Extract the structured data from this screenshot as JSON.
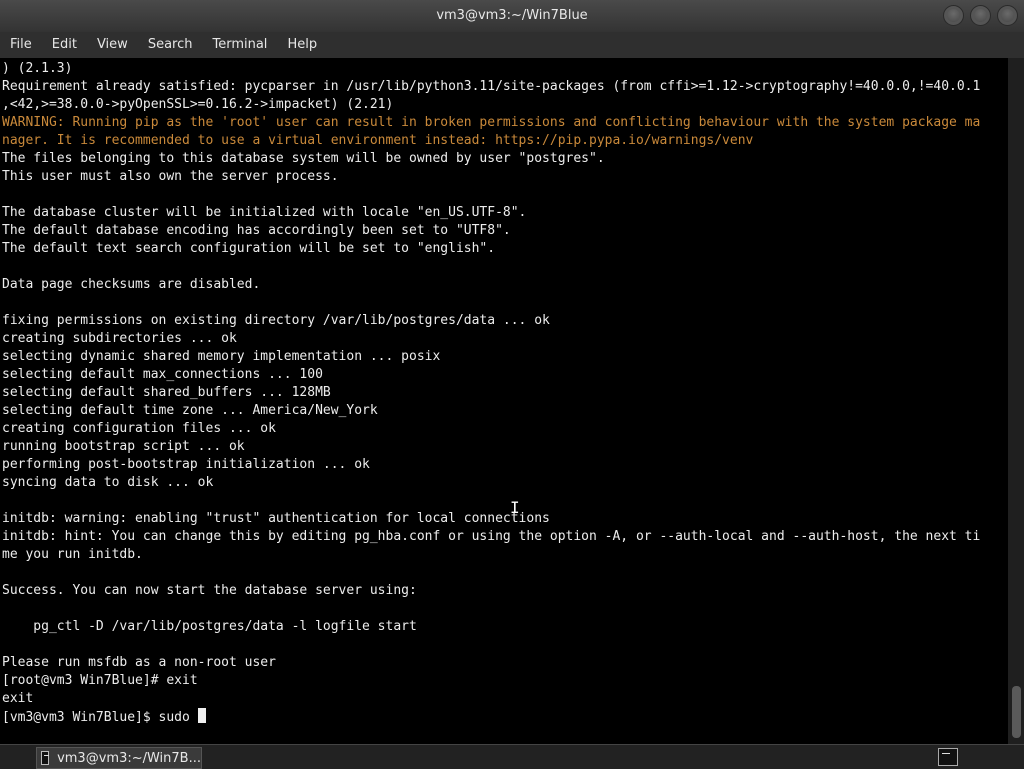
{
  "window": {
    "title": "vm3@vm3:~/Win7Blue"
  },
  "menu": {
    "items": [
      "File",
      "Edit",
      "View",
      "Search",
      "Terminal",
      "Help"
    ]
  },
  "terminal": {
    "lines": [
      {
        "text": ") (2.1.3)",
        "style": "normal"
      },
      {
        "text": "Requirement already satisfied: pycparser in /usr/lib/python3.11/site-packages (from cffi>=1.12->cryptography!=40.0.0,!=40.0.1",
        "style": "normal"
      },
      {
        "text": ",<42,>=38.0.0->pyOpenSSL>=0.16.2->impacket) (2.21)",
        "style": "normal"
      },
      {
        "text": "WARNING: Running pip as the 'root' user can result in broken permissions and conflicting behaviour with the system package ma",
        "style": "warn"
      },
      {
        "text": "nager. It is recommended to use a virtual environment instead: https://pip.pypa.io/warnings/venv",
        "style": "warn"
      },
      {
        "text": "The files belonging to this database system will be owned by user \"postgres\".",
        "style": "normal"
      },
      {
        "text": "This user must also own the server process.",
        "style": "normal"
      },
      {
        "text": "",
        "style": "normal"
      },
      {
        "text": "The database cluster will be initialized with locale \"en_US.UTF-8\".",
        "style": "normal"
      },
      {
        "text": "The default database encoding has accordingly been set to \"UTF8\".",
        "style": "normal"
      },
      {
        "text": "The default text search configuration will be set to \"english\".",
        "style": "normal"
      },
      {
        "text": "",
        "style": "normal"
      },
      {
        "text": "Data page checksums are disabled.",
        "style": "normal"
      },
      {
        "text": "",
        "style": "normal"
      },
      {
        "text": "fixing permissions on existing directory /var/lib/postgres/data ... ok",
        "style": "normal"
      },
      {
        "text": "creating subdirectories ... ok",
        "style": "normal"
      },
      {
        "text": "selecting dynamic shared memory implementation ... posix",
        "style": "normal"
      },
      {
        "text": "selecting default max_connections ... 100",
        "style": "normal"
      },
      {
        "text": "selecting default shared_buffers ... 128MB",
        "style": "normal"
      },
      {
        "text": "selecting default time zone ... America/New_York",
        "style": "normal"
      },
      {
        "text": "creating configuration files ... ok",
        "style": "normal"
      },
      {
        "text": "running bootstrap script ... ok",
        "style": "normal"
      },
      {
        "text": "performing post-bootstrap initialization ... ok",
        "style": "normal"
      },
      {
        "text": "syncing data to disk ... ok",
        "style": "normal"
      },
      {
        "text": "",
        "style": "normal"
      },
      {
        "text": "initdb: warning: enabling \"trust\" authentication for local connections",
        "style": "normal"
      },
      {
        "text": "initdb: hint: You can change this by editing pg_hba.conf or using the option -A, or --auth-local and --auth-host, the next ti",
        "style": "normal"
      },
      {
        "text": "me you run initdb.",
        "style": "normal"
      },
      {
        "text": "",
        "style": "normal"
      },
      {
        "text": "Success. You can now start the database server using:",
        "style": "normal"
      },
      {
        "text": "",
        "style": "normal"
      },
      {
        "text": "    pg_ctl -D /var/lib/postgres/data -l logfile start",
        "style": "normal"
      },
      {
        "text": "",
        "style": "normal"
      },
      {
        "text": "Please run msfdb as a non-root user",
        "style": "normal"
      },
      {
        "text": "[root@vm3 Win7Blue]# exit",
        "style": "normal"
      },
      {
        "text": "exit",
        "style": "normal"
      }
    ],
    "prompt": "[vm3@vm3 Win7Blue]$ sudo "
  },
  "taskbar": {
    "task_label": "vm3@vm3:~/Win7B..."
  },
  "icons": {
    "window_buttons": [
      "minimize-icon",
      "maximize-icon",
      "close-icon"
    ],
    "task": "terminal-icon",
    "tray": "terminal-tray-icon"
  },
  "colors": {
    "terminal_bg": "#000000",
    "terminal_fg": "#ededed",
    "warning_fg": "#c9893a"
  }
}
